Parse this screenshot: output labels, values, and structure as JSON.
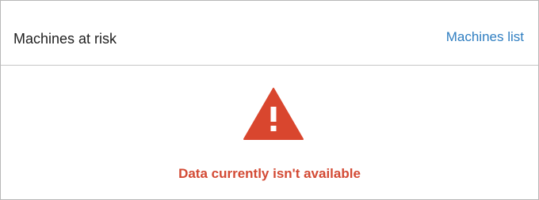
{
  "card": {
    "title": "Machines at risk",
    "link_label": "Machines list"
  },
  "status": {
    "icon": "warning-triangle-icon",
    "message": "Data currently isn't available"
  },
  "colors": {
    "link": "#2f7ec1",
    "error": "#d34a34",
    "warning_icon": "#d9462e"
  }
}
